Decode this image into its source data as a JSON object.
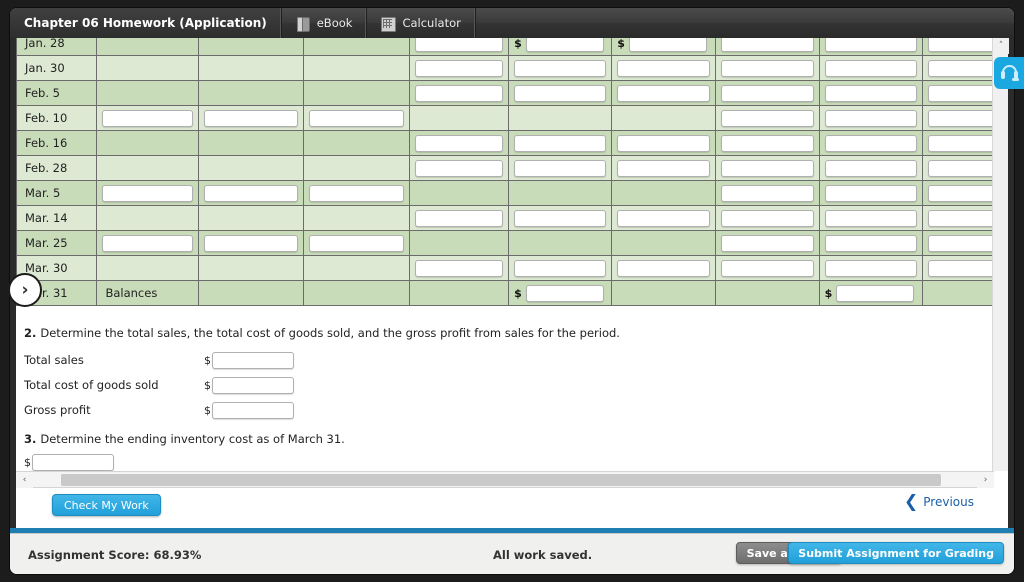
{
  "tabs": [
    {
      "label": "Chapter 06 Homework (Application)",
      "icon": null,
      "active": true
    },
    {
      "label": "eBook",
      "icon": "book-icon",
      "active": false
    },
    {
      "label": "Calculator",
      "icon": "calculator-icon",
      "active": false
    }
  ],
  "ledger": {
    "columns": [
      "date",
      "purchases-qty",
      "purchases-unit-cost",
      "purchases-total-cost",
      "cogs-qty",
      "cogs-unit-cost",
      "cogs-total-cost",
      "inv-qty",
      "inv-unit-cost",
      "inv-total-cost"
    ],
    "rows": [
      {
        "date": "Jan. 28",
        "label": "",
        "shade": "dark",
        "cells": [
          {
            "type": "blank"
          },
          {
            "type": "blank"
          },
          {
            "type": "blank"
          },
          {
            "type": "input",
            "value": "",
            "dollar": false
          },
          {
            "type": "input",
            "value": "",
            "dollar": true
          },
          {
            "type": "input",
            "value": "",
            "dollar": true
          },
          {
            "type": "input",
            "value": "",
            "dollar": false
          },
          {
            "type": "input",
            "value": "",
            "dollar": false
          },
          {
            "type": "input",
            "value": "",
            "dollar": false
          }
        ]
      },
      {
        "date": "Jan. 30",
        "label": "",
        "shade": "light",
        "cells": [
          {
            "type": "blank"
          },
          {
            "type": "blank"
          },
          {
            "type": "blank"
          },
          {
            "type": "input",
            "value": "",
            "dollar": false
          },
          {
            "type": "input",
            "value": "",
            "dollar": false
          },
          {
            "type": "input",
            "value": "",
            "dollar": false
          },
          {
            "type": "input",
            "value": "",
            "dollar": false
          },
          {
            "type": "input",
            "value": "",
            "dollar": false
          },
          {
            "type": "input",
            "value": "",
            "dollar": false
          }
        ]
      },
      {
        "date": "Feb. 5",
        "label": "",
        "shade": "dark",
        "cells": [
          {
            "type": "blank"
          },
          {
            "type": "blank"
          },
          {
            "type": "blank"
          },
          {
            "type": "input",
            "value": "",
            "dollar": false
          },
          {
            "type": "input",
            "value": "",
            "dollar": false
          },
          {
            "type": "input",
            "value": "",
            "dollar": false
          },
          {
            "type": "input",
            "value": "",
            "dollar": false
          },
          {
            "type": "input",
            "value": "",
            "dollar": false
          },
          {
            "type": "input",
            "value": "",
            "dollar": false
          }
        ]
      },
      {
        "date": "Feb. 10",
        "label": "",
        "shade": "light",
        "cells": [
          {
            "type": "input",
            "value": "",
            "dollar": false
          },
          {
            "type": "input",
            "value": "",
            "dollar": false
          },
          {
            "type": "input",
            "value": "",
            "dollar": false
          },
          {
            "type": "blank"
          },
          {
            "type": "blank"
          },
          {
            "type": "blank"
          },
          {
            "type": "input",
            "value": "",
            "dollar": false
          },
          {
            "type": "input",
            "value": "",
            "dollar": false
          },
          {
            "type": "input",
            "value": "",
            "dollar": false
          }
        ]
      },
      {
        "date": "Feb. 16",
        "label": "",
        "shade": "dark",
        "cells": [
          {
            "type": "blank"
          },
          {
            "type": "blank"
          },
          {
            "type": "blank"
          },
          {
            "type": "input",
            "value": "",
            "dollar": false
          },
          {
            "type": "input",
            "value": "",
            "dollar": false
          },
          {
            "type": "input",
            "value": "",
            "dollar": false
          },
          {
            "type": "input",
            "value": "",
            "dollar": false
          },
          {
            "type": "input",
            "value": "",
            "dollar": false
          },
          {
            "type": "input",
            "value": "",
            "dollar": false
          }
        ]
      },
      {
        "date": "Feb. 28",
        "label": "",
        "shade": "light",
        "cells": [
          {
            "type": "blank"
          },
          {
            "type": "blank"
          },
          {
            "type": "blank"
          },
          {
            "type": "input",
            "value": "",
            "dollar": false
          },
          {
            "type": "input",
            "value": "",
            "dollar": false
          },
          {
            "type": "input",
            "value": "",
            "dollar": false
          },
          {
            "type": "input",
            "value": "",
            "dollar": false
          },
          {
            "type": "input",
            "value": "",
            "dollar": false
          },
          {
            "type": "input",
            "value": "",
            "dollar": false
          }
        ]
      },
      {
        "date": "Mar. 5",
        "label": "",
        "shade": "dark",
        "cells": [
          {
            "type": "input",
            "value": "",
            "dollar": false
          },
          {
            "type": "input",
            "value": "",
            "dollar": false
          },
          {
            "type": "input",
            "value": "",
            "dollar": false
          },
          {
            "type": "blank"
          },
          {
            "type": "blank"
          },
          {
            "type": "blank"
          },
          {
            "type": "input",
            "value": "",
            "dollar": false
          },
          {
            "type": "input",
            "value": "",
            "dollar": false
          },
          {
            "type": "input",
            "value": "",
            "dollar": false
          }
        ]
      },
      {
        "date": "Mar. 14",
        "label": "",
        "shade": "light",
        "cells": [
          {
            "type": "blank"
          },
          {
            "type": "blank"
          },
          {
            "type": "blank"
          },
          {
            "type": "input",
            "value": "",
            "dollar": false
          },
          {
            "type": "input",
            "value": "",
            "dollar": false
          },
          {
            "type": "input",
            "value": "",
            "dollar": false
          },
          {
            "type": "input",
            "value": "",
            "dollar": false
          },
          {
            "type": "input",
            "value": "",
            "dollar": false
          },
          {
            "type": "input",
            "value": "",
            "dollar": false
          }
        ]
      },
      {
        "date": "Mar. 25",
        "label": "",
        "shade": "dark",
        "cells": [
          {
            "type": "input",
            "value": "",
            "dollar": false
          },
          {
            "type": "input",
            "value": "",
            "dollar": false
          },
          {
            "type": "input",
            "value": "",
            "dollar": false
          },
          {
            "type": "blank"
          },
          {
            "type": "blank"
          },
          {
            "type": "blank"
          },
          {
            "type": "input",
            "value": "",
            "dollar": false
          },
          {
            "type": "input",
            "value": "",
            "dollar": false
          },
          {
            "type": "input",
            "value": "",
            "dollar": false
          }
        ]
      },
      {
        "date": "Mar. 30",
        "label": "",
        "shade": "light",
        "cells": [
          {
            "type": "blank"
          },
          {
            "type": "blank"
          },
          {
            "type": "blank"
          },
          {
            "type": "input",
            "value": "",
            "dollar": false
          },
          {
            "type": "input",
            "value": "",
            "dollar": false
          },
          {
            "type": "input",
            "value": "",
            "dollar": false
          },
          {
            "type": "input",
            "value": "",
            "dollar": false
          },
          {
            "type": "input",
            "value": "",
            "dollar": false
          },
          {
            "type": "input",
            "value": "",
            "dollar": false
          }
        ]
      },
      {
        "date": "Mar. 31",
        "label": "Balances",
        "shade": "dark",
        "cells": [
          {
            "type": "blank"
          },
          {
            "type": "blank"
          },
          {
            "type": "blank"
          },
          {
            "type": "input",
            "value": "",
            "dollar": true
          },
          {
            "type": "blank"
          },
          {
            "type": "blank"
          },
          {
            "type": "input",
            "value": "",
            "dollar": true
          },
          {
            "type": "blank"
          }
        ]
      }
    ]
  },
  "questions": {
    "q2": {
      "number": "2.",
      "text": "Determine the total sales, the total cost of goods sold, and the gross profit from sales for the period.",
      "rows": [
        {
          "label": "Total sales",
          "dollar": "$",
          "value": ""
        },
        {
          "label": "Total cost of goods sold",
          "dollar": "$",
          "value": ""
        },
        {
          "label": "Gross profit",
          "dollar": "$",
          "value": ""
        }
      ]
    },
    "q3": {
      "number": "3.",
      "text": "Determine the ending inventory cost as of March 31.",
      "dollar": "$",
      "value": ""
    }
  },
  "actions": {
    "check_my_work": "Check My Work",
    "previous": "Previous",
    "previous_icon": "chevron-left-icon"
  },
  "footer": {
    "score": "Assignment Score: 68.93%",
    "saved": "All work saved.",
    "save_and_exit": "Save and Exit",
    "submit": "Submit Assignment for Grading"
  },
  "chrome": {
    "expand_handle": "›",
    "support_icon": "headset-icon",
    "vscroll_up": "˄",
    "hscroll_left": "‹",
    "hscroll_right": "›"
  },
  "colors": {
    "accent_blue": "#22a0da",
    "row_dark": "#c9dcba",
    "row_light": "#dde9d2",
    "footer_rule": "#1f7fb5",
    "link_blue": "#1b5fa8"
  }
}
